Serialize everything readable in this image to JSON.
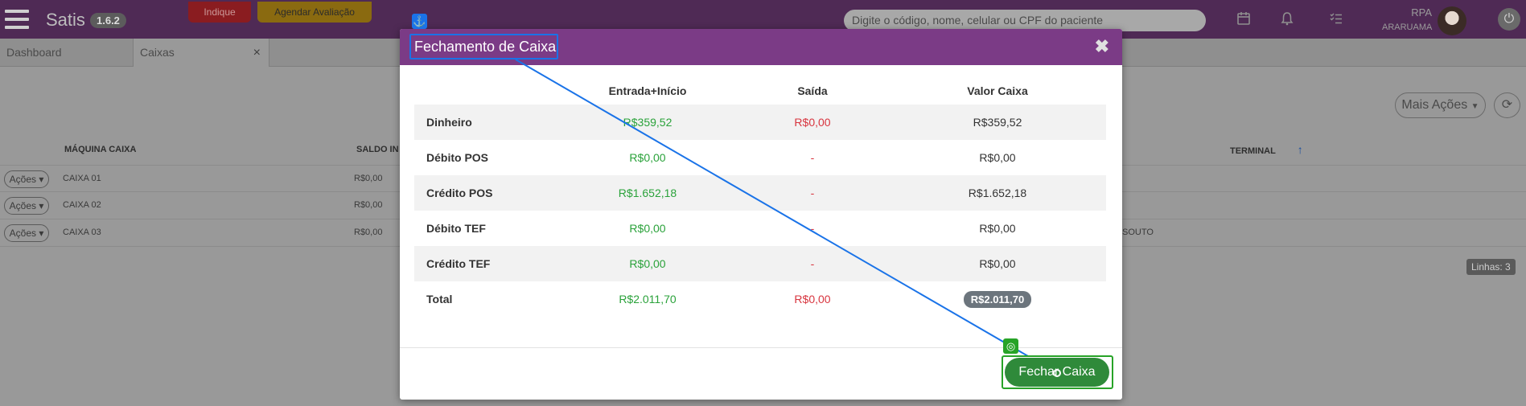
{
  "app": {
    "brand": "Satis",
    "version": "1.6.2",
    "indique_label": "Indique",
    "agendar_label": "Agendar Avaliação",
    "search_placeholder": "Digite o código, nome, celular ou CPF do paciente",
    "user_name": "RPA",
    "user_city": "ARARUAMA"
  },
  "tabs": [
    {
      "label": "Dashboard"
    },
    {
      "label": "Caixas",
      "close": "×"
    }
  ],
  "toolbar": {
    "mais_acoes_label": "Mais Ações"
  },
  "grid": {
    "headers": {
      "maquina": "MÁQUINA CAIXA",
      "saldo": "SALDO IN",
      "terminal": "TERMINAL"
    },
    "rows": [
      {
        "action": "Ações",
        "maquina": "CAIXA 01",
        "saldo": "R$0,00",
        "terminal": ""
      },
      {
        "action": "Ações",
        "maquina": "CAIXA 02",
        "saldo": "R$0,00",
        "terminal": ""
      },
      {
        "action": "Ações",
        "maquina": "CAIXA 03",
        "saldo": "R$0,00",
        "terminal": "SOUTO"
      }
    ],
    "row_count_label": "Linhas: 3"
  },
  "modal": {
    "title": "Fechamento de Caixa",
    "close": "✖",
    "columns": [
      "",
      "Entrada+Início",
      "Saída",
      "Valor Caixa"
    ],
    "rows": [
      {
        "label": "Dinheiro",
        "entrada": "R$359,52",
        "saida": "R$0,00",
        "valor": "R$359,52"
      },
      {
        "label": "Débito POS",
        "entrada": "R$0,00",
        "saida": "-",
        "valor": "R$0,00"
      },
      {
        "label": "Crédito POS",
        "entrada": "R$1.652,18",
        "saida": "-",
        "valor": "R$1.652,18"
      },
      {
        "label": "Débito TEF",
        "entrada": "R$0,00",
        "saida": "-",
        "valor": "R$0,00"
      },
      {
        "label": "Crédito TEF",
        "entrada": "R$0,00",
        "saida": "-",
        "valor": "R$0,00"
      }
    ],
    "total": {
      "label": "Total",
      "entrada": "R$2.011,70",
      "saida": "R$0,00",
      "valor": "R$2.011,70"
    },
    "confirm_label": "Fechar Caixa"
  },
  "colors": {
    "header_purple": "#7b3b86",
    "topbar": "#4f2a55",
    "positive": "#2aa23a",
    "negative": "#d8353f",
    "confirm_button": "#2f8a3a",
    "annotation_source": "#1a73e8",
    "annotation_target": "#27a327"
  },
  "icons": {
    "menu": "hamburger-icon",
    "calendar": "calendar-icon",
    "notifications": "bell-icon",
    "tasks": "checklist-icon",
    "power": "power-icon",
    "refresh": "refresh-icon",
    "sort": "sort-up-arrow-icon",
    "anchor": "anchor-icon",
    "target": "target-icon"
  }
}
